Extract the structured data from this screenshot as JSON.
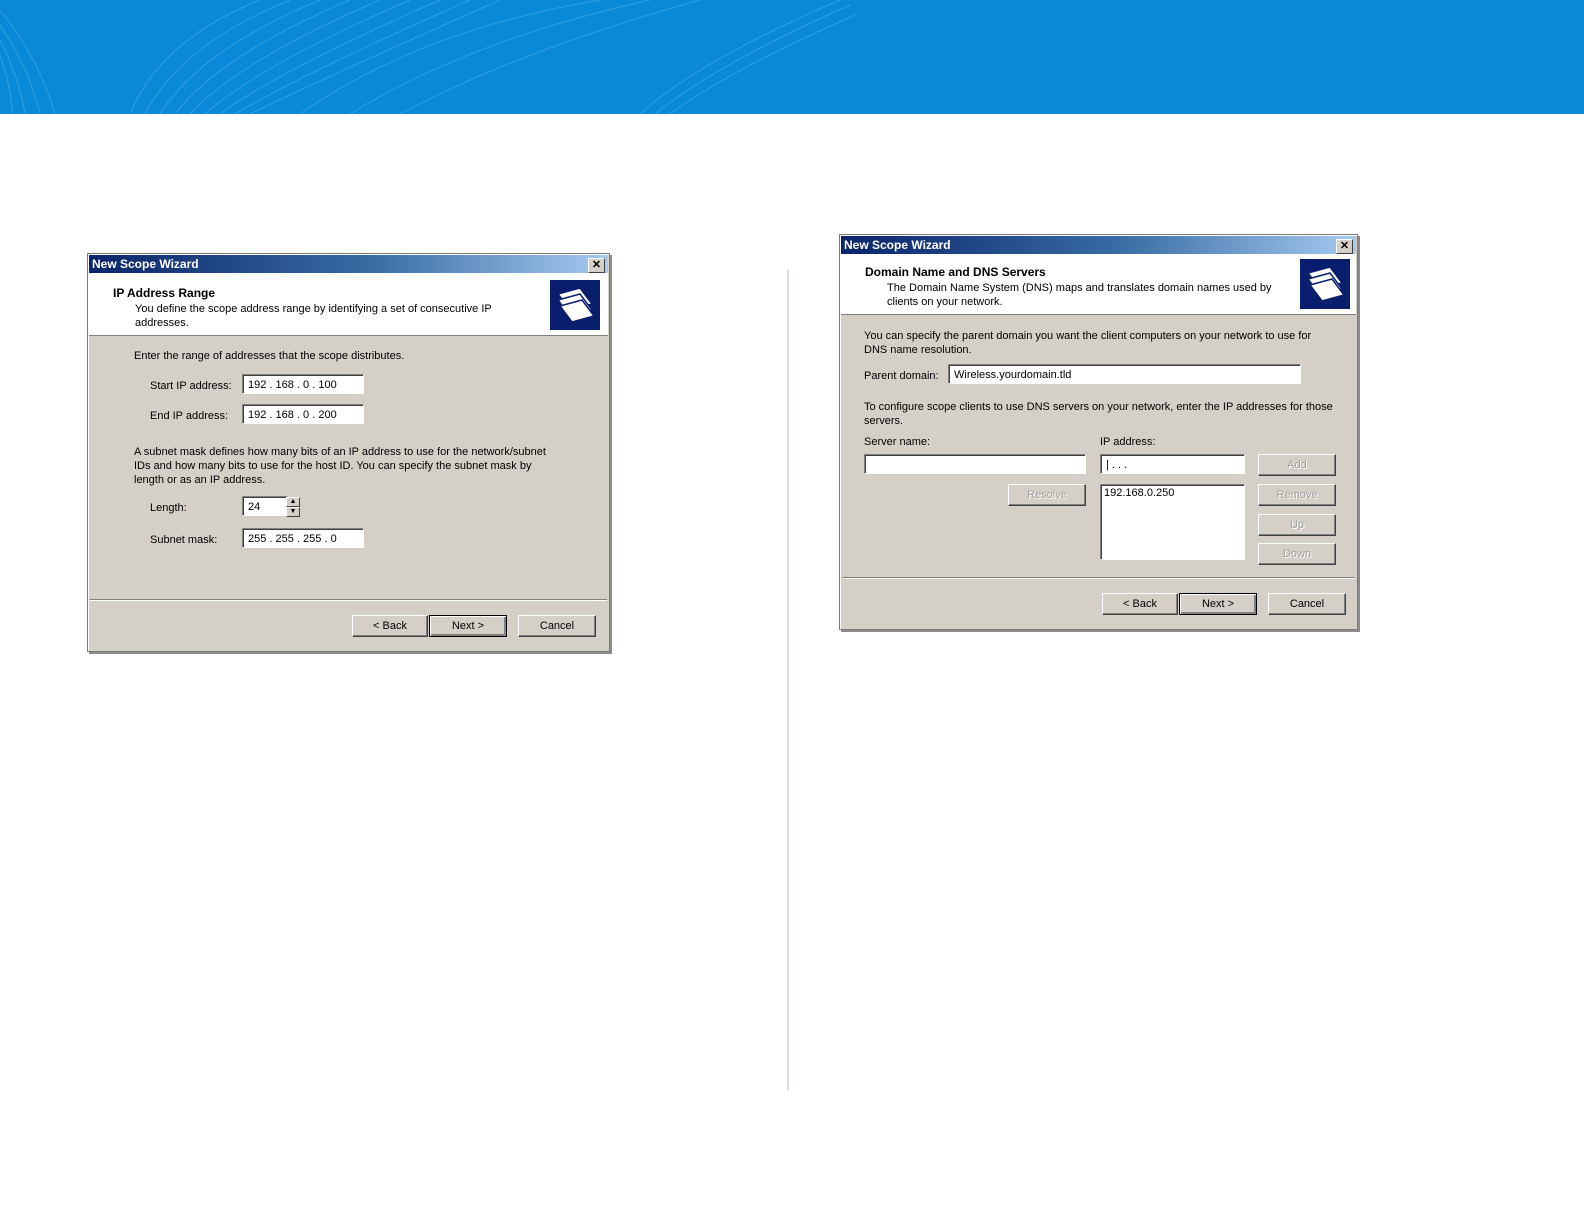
{
  "colors": {
    "banner": "#0a8ad6",
    "titlebar": "#0a246a",
    "dialog_face": "#d4d0c8"
  },
  "icons": {
    "close": "close-icon",
    "wizard": "wizard-folder-icon",
    "spin_up": "spin-up-icon",
    "spin_down": "spin-down-icon"
  },
  "dialog1": {
    "title": "New Scope Wizard",
    "close_glyph": "✕",
    "header_title": "IP Address Range",
    "header_desc_line1": "You define the scope address range by identifying a set of consecutive IP",
    "header_desc_line2": "addresses.",
    "intro": "Enter the range of addresses that the scope distributes.",
    "start_label": "Start IP address:",
    "start_value": "192 . 168 .   0   . 100",
    "end_label": "End IP address:",
    "end_value": "192 . 168 .   0   . 200",
    "subnet_desc_line1": "A subnet mask defines how many bits of an IP address to use for the network/subnet",
    "subnet_desc_line2": "IDs and how many bits to use for the host ID. You can specify the subnet mask by",
    "subnet_desc_line3": "length or as an IP address.",
    "length_label": "Length:",
    "length_value": "24",
    "mask_label": "Subnet mask:",
    "mask_value": "255 . 255 . 255 .   0",
    "back_label": "< Back",
    "next_label": "Next >",
    "cancel_label": "Cancel"
  },
  "dialog2": {
    "title": "New Scope Wizard",
    "close_glyph": "✕",
    "header_title": "Domain Name and DNS Servers",
    "header_desc_line1": "The Domain Name System (DNS) maps and translates domain names used by",
    "header_desc_line2": "clients on your network.",
    "intro_line1": "You can specify the parent domain you want the client computers on your network to use for",
    "intro_line2": "DNS name resolution.",
    "parent_label": "Parent domain:",
    "parent_value": "Wireless.yourdomain.tld",
    "config_line1": "To configure scope clients to use DNS servers on your network, enter the IP addresses for those",
    "config_line2": "servers.",
    "server_label": "Server name:",
    "server_value": "",
    "ip_label": "IP address:",
    "ip_value": "|    .       .       .",
    "resolve_label": "Resolve",
    "ip_list": [
      "192.168.0.250"
    ],
    "add_label": "Add",
    "remove_label": "Remove",
    "up_label": "Up",
    "down_label": "Down",
    "back_label": "< Back",
    "next_label": "Next >",
    "cancel_label": "Cancel"
  }
}
